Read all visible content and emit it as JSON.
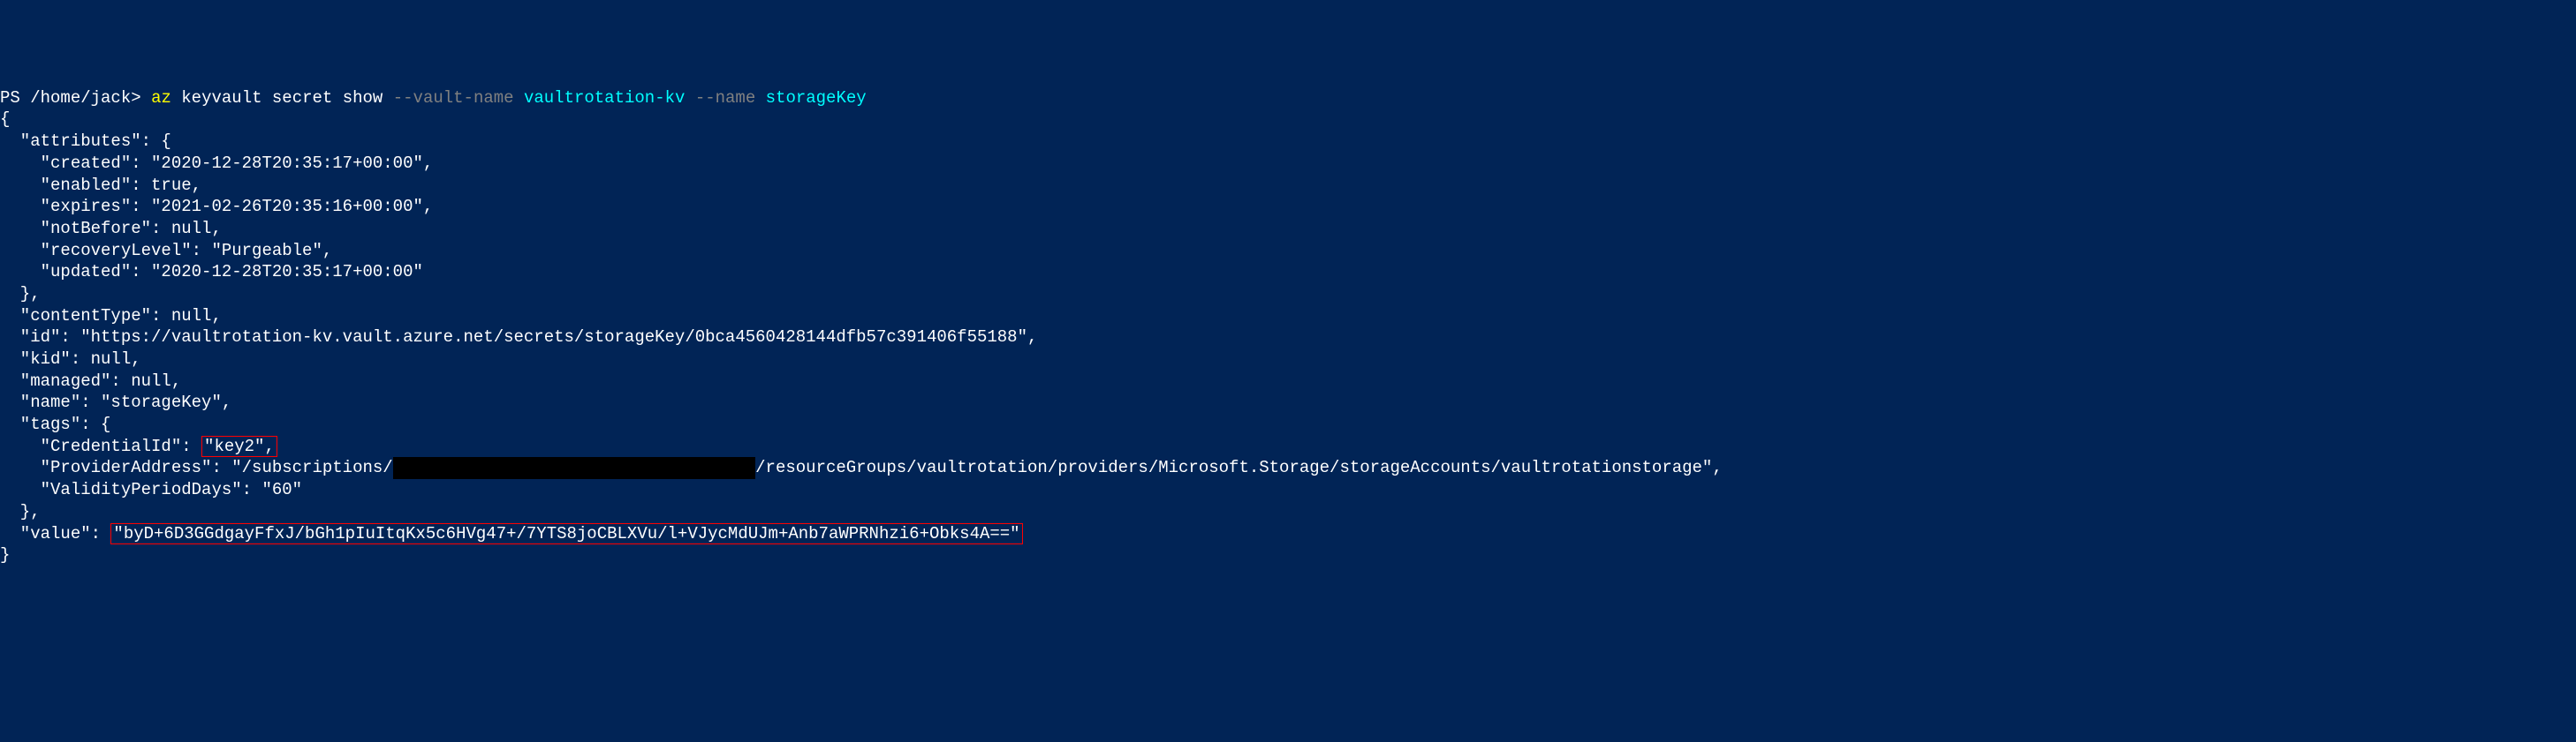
{
  "prompt": {
    "ps": "PS ",
    "path": "/home/jack",
    "rangle": "> ",
    "cmd_az": "az ",
    "cmd_keyvault": "keyvault secret show ",
    "flag_vault": "--vault-name ",
    "val_vault": "vaultrotation-kv ",
    "flag_name": "--name ",
    "val_name": "storageKey"
  },
  "output": {
    "open": "{",
    "attrs_open": "  \"attributes\": {",
    "created": "    \"created\": \"2020-12-28T20:35:17+00:00\",",
    "enabled": "    \"enabled\": true,",
    "expires": "    \"expires\": \"2021-02-26T20:35:16+00:00\",",
    "notBefore": "    \"notBefore\": null,",
    "recoveryLevel": "    \"recoveryLevel\": \"Purgeable\",",
    "updated": "    \"updated\": \"2020-12-28T20:35:17+00:00\"",
    "attrs_close": "  },",
    "contentType": "  \"contentType\": null,",
    "id": "  \"id\": \"https://vaultrotation-kv.vault.azure.net/secrets/storageKey/0bca4560428144dfb57c391406f55188\",",
    "kid": "  \"kid\": null,",
    "managed": "  \"managed\": null,",
    "name": "  \"name\": \"storageKey\",",
    "tags_open": "  \"tags\": {",
    "credId_key": "    \"CredentialId\": ",
    "credId_val": "\"key2\",",
    "provAddr_pre": "    \"ProviderAddress\": \"/subscriptions/",
    "provAddr_redacted": "XXXXXXXXXXXXXXXXXXXXXXXXXXXXXXXXXXXX",
    "provAddr_post": "/resourceGroups/vaultrotation/providers/Microsoft.Storage/storageAccounts/vaultrotationstorage\",",
    "validity": "    \"ValidityPeriodDays\": \"60\"",
    "tags_close": "  },",
    "value_key": "  \"value\": ",
    "value_val": "\"byD+6D3GGdgayFfxJ/bGh1pIuItqKx5c6HVg47+/7YTS8joCBLXVu/l+VJycMdUJm+Anb7aWPRNhzi6+Obks4A==\"",
    "close": "}"
  }
}
